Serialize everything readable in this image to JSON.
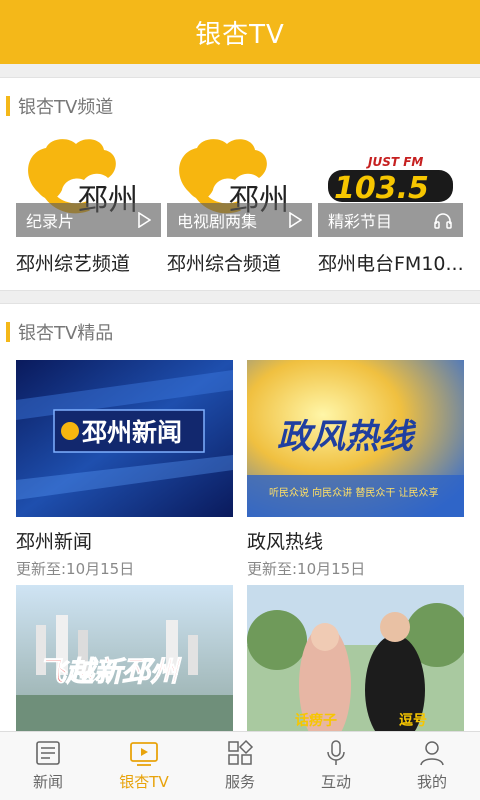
{
  "header": {
    "title": "银杏TV"
  },
  "channels_section": {
    "title": "银杏TV频道",
    "items": [
      {
        "tag": "纪录片",
        "tag_icon": "play-icon",
        "name": "邳州综艺频道",
        "logo_text": "邳州"
      },
      {
        "tag": "电视剧两集",
        "tag_icon": "play-icon",
        "name": "邳州综合频道",
        "logo_text": "邳州"
      },
      {
        "tag": "精彩节目",
        "tag_icon": "headphones-icon",
        "name": "邳州电台FM10...",
        "logo_top": "JUST FM",
        "logo_num": "103.5"
      }
    ]
  },
  "programs_section": {
    "title": "银杏TV精品",
    "items": [
      {
        "title": "邳州新闻",
        "update": "更新至:10月15日",
        "thumb_text": "邳州新闻"
      },
      {
        "title": "政风热线",
        "update": "更新至:10月15日",
        "thumb_text": "政风热线",
        "thumb_sub": "听民众说 向民众讲 替民众干 让民众享"
      },
      {
        "title": "",
        "update": "",
        "thumb_text": "飞越新邳州"
      },
      {
        "title": "",
        "update": "",
        "thumb_text_left": "话痨子",
        "thumb_text_right": "逗号"
      }
    ]
  },
  "nav": {
    "items": [
      {
        "label": "新闻",
        "icon": "newspaper-icon"
      },
      {
        "label": "银杏TV",
        "icon": "tv-icon",
        "active": true
      },
      {
        "label": "服务",
        "icon": "grid-icon"
      },
      {
        "label": "互动",
        "icon": "microphone-icon"
      },
      {
        "label": "我的",
        "icon": "user-icon"
      }
    ]
  },
  "colors": {
    "accent": "#f4b819",
    "nav_active": "#e8a30c"
  }
}
